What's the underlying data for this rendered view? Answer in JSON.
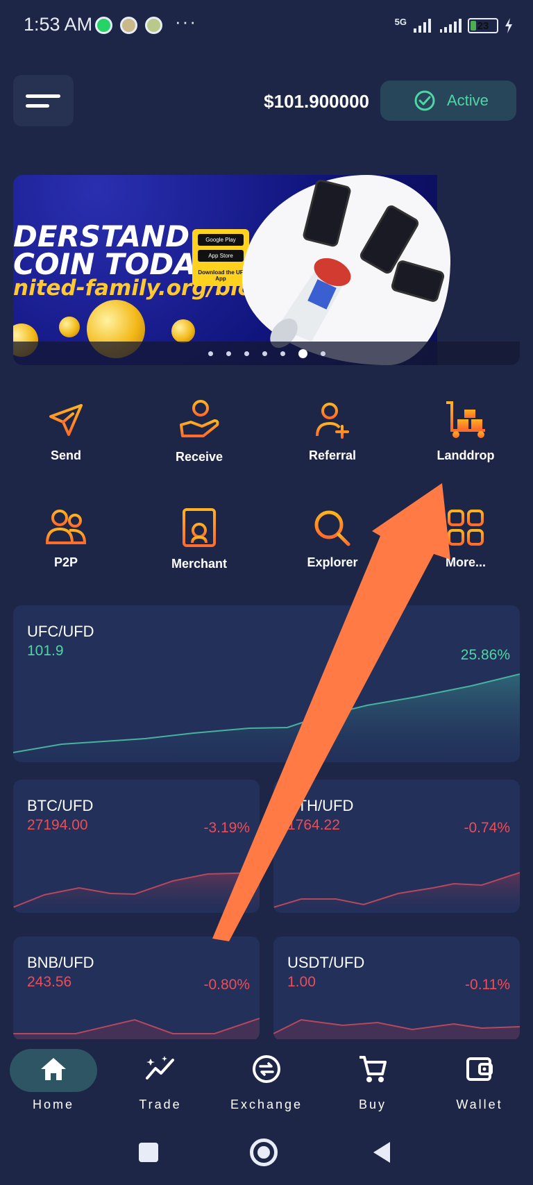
{
  "status_bar": {
    "time": "1:53 AM",
    "more": "···",
    "network": "5G",
    "battery": "23",
    "battery_level": 0.23,
    "icons": [
      "whatsapp-icon",
      "app-notification-icon",
      "app-notification-icon",
      "signal-icon",
      "signal-icon",
      "battery-icon",
      "charging-icon"
    ]
  },
  "header": {
    "balance": "$101.900000",
    "status_label": "Active",
    "icons": [
      "hamburger-menu-icon",
      "check-circle-icon"
    ]
  },
  "banner": {
    "line1": "DERSTAND",
    "line2": "COIN TODAY!",
    "url": "nited-family.org/blog",
    "google_play_prefix": "GET IT ON",
    "google_play": "Google Play",
    "app_store_prefix": "Download on the",
    "app_store": "App Store",
    "caption": "Download the UF App",
    "slide_count": 7,
    "active_slide": 5
  },
  "actions": [
    {
      "label": "Send",
      "icon": "send-icon"
    },
    {
      "label": "Receive",
      "icon": "receive-coin-icon"
    },
    {
      "label": "Referral",
      "icon": "add-user-icon"
    },
    {
      "label": "Landdrop",
      "icon": "landdrop-cart-icon"
    },
    {
      "label": "P2P",
      "icon": "users-icon"
    },
    {
      "label": "Merchant",
      "icon": "merchant-store-icon"
    },
    {
      "label": "Explorer",
      "icon": "search-icon"
    },
    {
      "label": "More...",
      "icon": "grid-icon"
    }
  ],
  "markets": [
    {
      "pair": "UFC/UFD",
      "price": "101.9",
      "change": "25.86%",
      "trend": "up"
    },
    {
      "pair": "BTC/UFD",
      "price": "27194.00",
      "change": "-3.19%",
      "trend": "down"
    },
    {
      "pair": "ETH/UFD",
      "price": "1764.22",
      "change": "-0.74%",
      "trend": "down"
    },
    {
      "pair": "BNB/UFD",
      "price": "243.56",
      "change": "-0.80%",
      "trend": "down"
    },
    {
      "pair": "USDT/UFD",
      "price": "1.00",
      "change": "-0.11%",
      "trend": "down"
    }
  ],
  "bottom_nav": [
    {
      "label": "Home",
      "icon": "home-icon",
      "active": true
    },
    {
      "label": "Trade",
      "icon": "trade-chart-icon",
      "active": false
    },
    {
      "label": "Exchange",
      "icon": "exchange-icon",
      "active": false
    },
    {
      "label": "Buy",
      "icon": "cart-icon",
      "active": false
    },
    {
      "label": "Wallet",
      "icon": "wallet-icon",
      "active": false
    }
  ],
  "system_nav": [
    "recents-button",
    "home-button",
    "back-button"
  ],
  "colors": {
    "background": "#1d2647",
    "card": "#22305a",
    "accent_orange": "#ff7a45",
    "positive": "#4fd6a4",
    "negative": "#f04c57",
    "active_pill": "#27465a",
    "home_pill": "#2e5564"
  }
}
